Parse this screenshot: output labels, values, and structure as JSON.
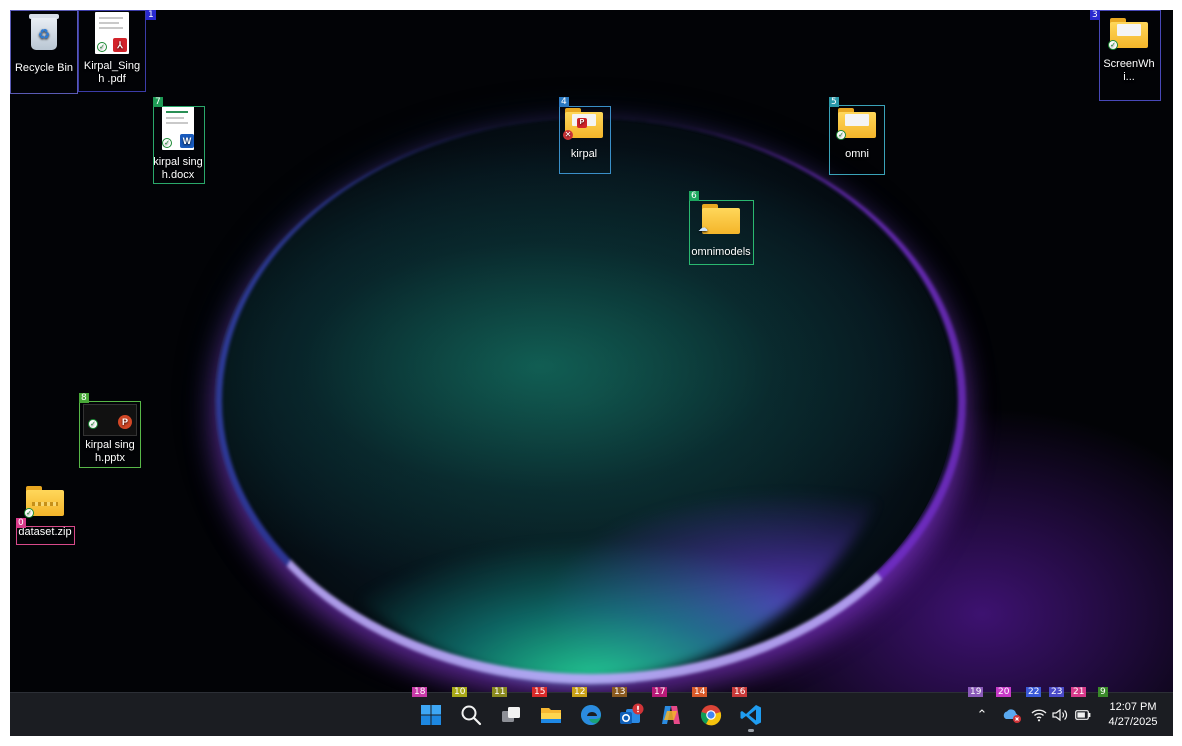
{
  "desktop": {
    "icons": [
      {
        "name": "Recycle Bin",
        "label": "Recycle Bin",
        "marker": ""
      },
      {
        "name": "Kirpal_Singh.pdf",
        "label": "Kirpal_Singh .pdf",
        "marker": "1"
      },
      {
        "name": "ScreenWhi...",
        "label": "ScreenWhi...",
        "marker": "3"
      },
      {
        "name": "kirpal singh.docx",
        "label": "kirpal singh.docx",
        "marker": "7"
      },
      {
        "name": "kirpal",
        "label": "kirpal",
        "marker": "4"
      },
      {
        "name": "omni",
        "label": "omni",
        "marker": "5"
      },
      {
        "name": "omnimodels",
        "label": "omnimodels",
        "marker": "6"
      },
      {
        "name": "kirpal singh.pptx",
        "label": "kirpal singh.pptx",
        "marker": "8"
      },
      {
        "name": "dataset.zip",
        "label": "dataset.zip",
        "marker": "0"
      }
    ]
  },
  "taskbar": {
    "apps": [
      {
        "name": "Start",
        "marker": "18",
        "icon": "windows-start-icon"
      },
      {
        "name": "Search",
        "marker": "10",
        "icon": "search-icon"
      },
      {
        "name": "Task View",
        "marker": "11",
        "icon": "task-view-icon"
      },
      {
        "name": "File Explorer",
        "marker": "15",
        "icon": "file-explorer-icon"
      },
      {
        "name": "Microsoft Edge",
        "marker": "12",
        "icon": "edge-icon"
      },
      {
        "name": "Outlook",
        "marker": "13",
        "icon": "outlook-icon"
      },
      {
        "name": "Copilot",
        "marker": "17",
        "icon": "copilot-icon"
      },
      {
        "name": "Google Chrome",
        "marker": "14",
        "icon": "chrome-icon"
      },
      {
        "name": "Visual Studio Code",
        "marker": "16",
        "icon": "vscode-icon"
      }
    ],
    "tray": {
      "chevron_marker": "19",
      "onedrive_marker": "20",
      "wifi_marker": "22",
      "volume_marker": "23",
      "battery_marker": "21",
      "clock_marker": "9",
      "time": "12:07 PM",
      "date": "4/27/2025"
    }
  },
  "colors": {
    "taskbar_bg": "#1b1d22",
    "folder_yellow": "#f4b52a",
    "accent_blue": "#0078d4"
  }
}
